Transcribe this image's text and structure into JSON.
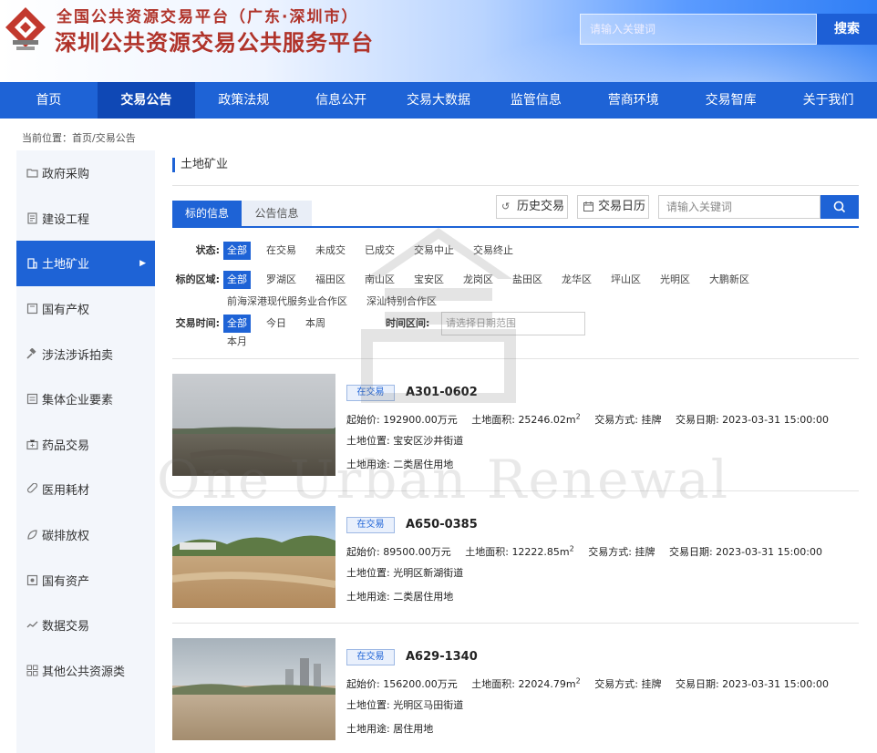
{
  "header": {
    "site_subtitle": "全国公共资源交易平台（广东·深圳市）",
    "site_title": "深圳公共资源交易公共服务平台",
    "search_placeholder": "请输入关键词",
    "search_button": "搜索"
  },
  "nav": {
    "items": [
      "首页",
      "交易公告",
      "政策法规",
      "信息公开",
      "交易大数据",
      "监管信息",
      "营商环境",
      "交易智库",
      "关于我们"
    ],
    "active_index": 1
  },
  "breadcrumb": "当前位置：首页/交易公告",
  "sidebar": {
    "items": [
      {
        "label": "政府采购",
        "icon": "folder-icon"
      },
      {
        "label": "建设工程",
        "icon": "document-icon"
      },
      {
        "label": "土地矿业",
        "icon": "building-icon"
      },
      {
        "label": "国有产权",
        "icon": "certificate-icon"
      },
      {
        "label": "涉法涉诉拍卖",
        "icon": "gavel-icon"
      },
      {
        "label": "集体企业要素",
        "icon": "list-icon"
      },
      {
        "label": "药品交易",
        "icon": "medkit-icon"
      },
      {
        "label": "医用耗材",
        "icon": "pill-icon"
      },
      {
        "label": "碳排放权",
        "icon": "leaf-icon"
      },
      {
        "label": "国有资产",
        "icon": "asset-icon"
      },
      {
        "label": "数据交易",
        "icon": "data-icon"
      },
      {
        "label": "其他公共资源类",
        "icon": "grid-icon"
      }
    ],
    "active_index": 2
  },
  "main": {
    "section_title": "土地矿业",
    "tabs": [
      "标的信息",
      "公告信息"
    ],
    "active_tab": 0,
    "history_button": "历史交易",
    "calendar_button": "交易日历",
    "search_placeholder": "请输入关键词",
    "filters": {
      "status": {
        "label": "状态:",
        "options": [
          "全部",
          "在交易",
          "未成交",
          "已成交",
          "交易中止",
          "交易终止"
        ]
      },
      "region": {
        "label": "标的区域:",
        "options": [
          "全部",
          "罗湖区",
          "福田区",
          "南山区",
          "宝安区",
          "龙岗区",
          "盐田区",
          "龙华区",
          "坪山区",
          "光明区",
          "大鹏新区",
          "前海深港现代服务业合作区",
          "深汕特别合作区"
        ]
      },
      "time": {
        "label": "交易时间:",
        "options": [
          "全部",
          "今日",
          "本周",
          "本月"
        ]
      },
      "date_range_label": "时间区间:",
      "date_range_placeholder": "请选择日期范围"
    }
  },
  "listings": [
    {
      "badge": "在交易",
      "id": "A301-0602",
      "price_label": "起始价:",
      "price": "192900.00万元",
      "area_label": "土地面积:",
      "area": "25246.02m",
      "method_label": "交易方式:",
      "method": "挂牌",
      "date_label": "交易日期:",
      "date": "2023-03-31 15:00:00",
      "location_label": "土地位置:",
      "location": "宝安区沙井街道",
      "use_label": "土地用途:",
      "use": "二类居住用地"
    },
    {
      "badge": "在交易",
      "id": "A650-0385",
      "price_label": "起始价:",
      "price": "89500.00万元",
      "area_label": "土地面积:",
      "area": "12222.85m",
      "method_label": "交易方式:",
      "method": "挂牌",
      "date_label": "交易日期:",
      "date": "2023-03-31 15:00:00",
      "location_label": "土地位置:",
      "location": "光明区新湖街道",
      "use_label": "土地用途:",
      "use": "二类居住用地"
    },
    {
      "badge": "在交易",
      "id": "A629-1340",
      "price_label": "起始价:",
      "price": "156200.00万元",
      "area_label": "土地面积:",
      "area": "22024.79m",
      "method_label": "交易方式:",
      "method": "挂牌",
      "date_label": "交易日期:",
      "date": "2023-03-31 15:00:00",
      "location_label": "土地位置:",
      "location": "光明区马田街道",
      "use_label": "土地用途:",
      "use": "居住用地"
    }
  ],
  "watermark": {
    "text": "One Urban Renewal"
  },
  "colors": {
    "primary": "#1e63d6",
    "nav_active": "#0f48b5",
    "brand_red": "#b0332a"
  }
}
